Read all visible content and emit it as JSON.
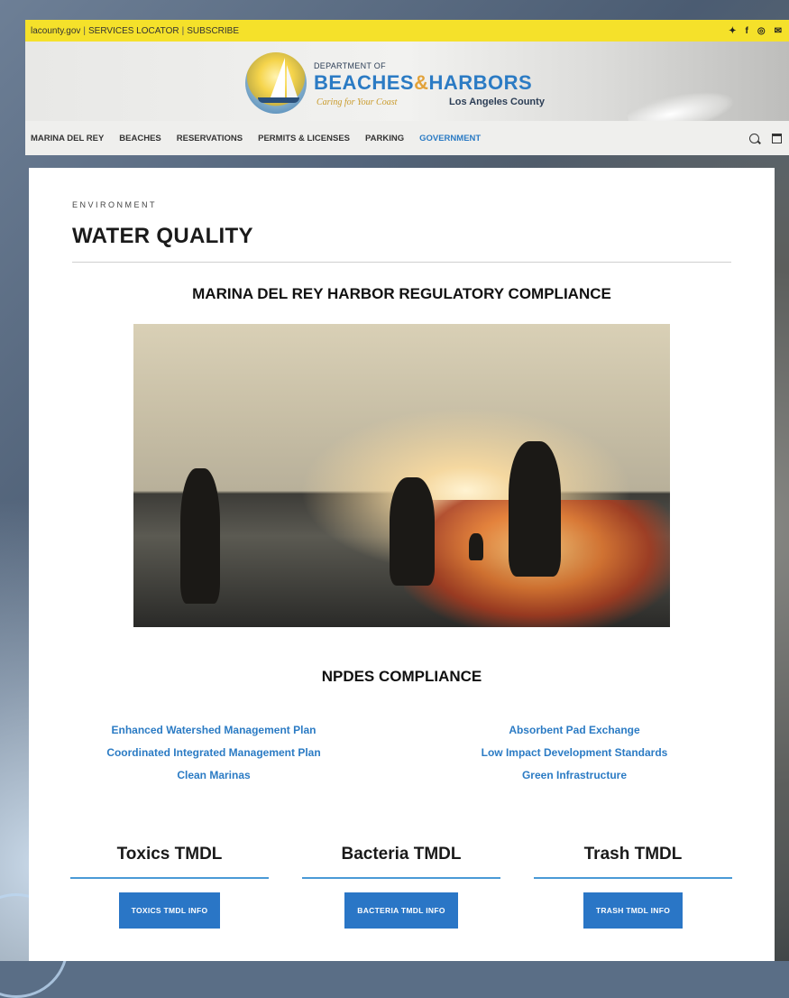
{
  "topbar": {
    "links": [
      "lacounty.gov",
      "SERVICES LOCATOR",
      "SUBSCRIBE"
    ],
    "separator": "|",
    "social": {
      "twitter": "✦",
      "facebook": "f",
      "instagram": "◎",
      "email": "✉"
    }
  },
  "brand": {
    "dept_line": "DEPARTMENT OF",
    "name_a": "BEACHES",
    "amp": "&",
    "name_b": "HARBORS",
    "tagline": "Caring for Your Coast",
    "county": "Los Angeles County"
  },
  "nav": {
    "items": [
      {
        "label": "MARINA DEL REY"
      },
      {
        "label": "BEACHES"
      },
      {
        "label": "RESERVATIONS"
      },
      {
        "label": "PERMITS & LICENSES"
      },
      {
        "label": "PARKING"
      },
      {
        "label": "GOVERNMENT",
        "active": true
      }
    ]
  },
  "page": {
    "eyebrow": "ENVIRONMENT",
    "title": "WATER QUALITY",
    "section_title": "MARINA DEL REY HARBOR REGULATORY COMPLIANCE",
    "npdes_title": "NPDES COMPLIANCE",
    "npdes_left": [
      "Enhanced Watershed Management Plan",
      "Coordinated Integrated Management Plan",
      "Clean Marinas"
    ],
    "npdes_right": [
      "Absorbent Pad Exchange",
      "Low Impact Development Standards",
      "Green Infrastructure"
    ],
    "tmdl": [
      {
        "heading": "Toxics TMDL",
        "button": "TOXICS TMDL INFO"
      },
      {
        "heading": "Bacteria TMDL",
        "button": "BACTERIA TMDL INFO"
      },
      {
        "heading": "Trash TMDL",
        "button": "TRASH TMDL INFO"
      }
    ]
  },
  "colors": {
    "topbar": "#f5e12a",
    "link_blue": "#2b7bc4",
    "button_blue": "#2a76c6",
    "tmdl_rule": "#4a9ad6"
  }
}
